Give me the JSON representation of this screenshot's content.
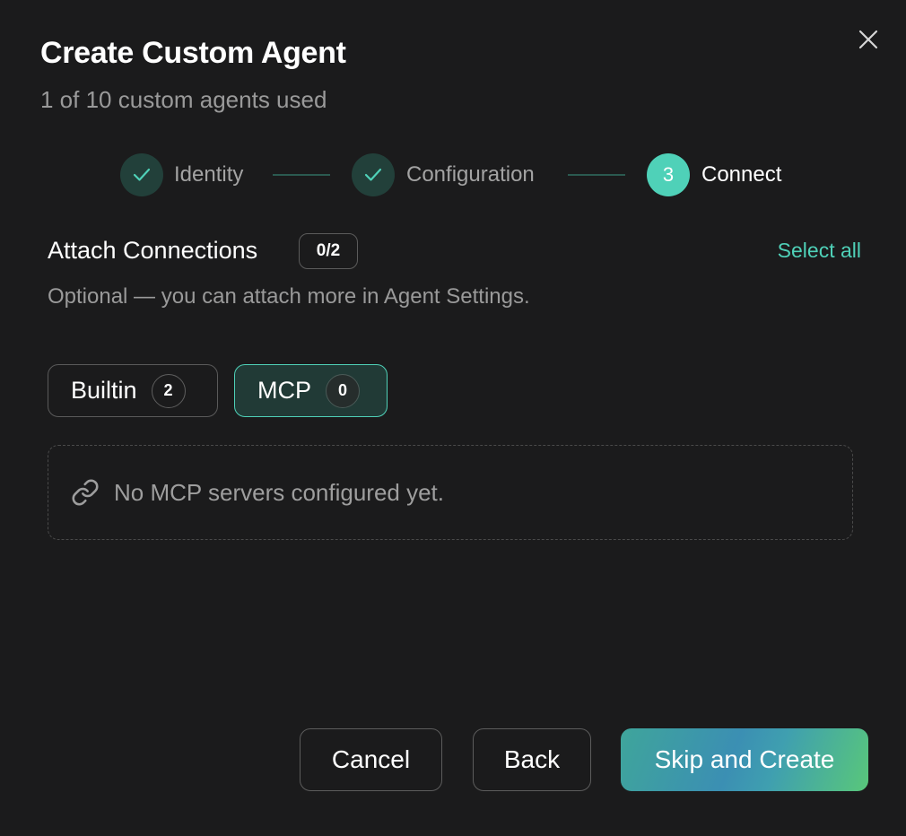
{
  "dialog": {
    "title": "Create Custom Agent",
    "subtitle": "1 of 10 custom agents used"
  },
  "stepper": {
    "steps": [
      {
        "label": "Identity",
        "status": "done",
        "icon": "check-icon"
      },
      {
        "label": "Configuration",
        "status": "done",
        "icon": "check-icon"
      },
      {
        "label": "Connect",
        "status": "active",
        "number": "3"
      }
    ]
  },
  "connections": {
    "title": "Attach Connections",
    "count": "0/2",
    "select_all": "Select all",
    "hint": "Optional — you can attach more in Agent Settings."
  },
  "tabs": [
    {
      "label": "Builtin",
      "count": "2",
      "selected": false
    },
    {
      "label": "MCP",
      "count": "0",
      "selected": true
    }
  ],
  "empty_state": {
    "icon": "link-icon",
    "text": "No MCP servers configured yet."
  },
  "buttons": {
    "cancel": "Cancel",
    "back": "Back",
    "primary": "Skip and Create"
  },
  "colors": {
    "background": "#1b1b1c",
    "accent": "#4fd1b8",
    "done_step": "#22403a",
    "muted_text": "#9a9a9a"
  }
}
